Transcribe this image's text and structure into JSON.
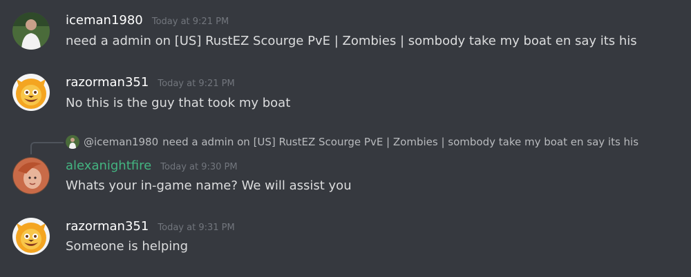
{
  "messages": [
    {
      "username": "iceman1980",
      "timestamp": "Today at 9:21 PM",
      "content": "need a admin on [US] RustEZ Scourge PvE | Zombies | sombody take my boat en say its  his",
      "username_color": "#ffffff",
      "avatar": "photo-avatar"
    },
    {
      "username": "razorman351",
      "timestamp": "Today at 9:21 PM",
      "content": "No this is the guy that took my boat",
      "username_color": "#ffffff",
      "avatar": "cartoon-lion-avatar"
    },
    {
      "reply": {
        "author": "@iceman1980",
        "content": "need a admin on [US] RustEZ Scourge PvE | Zombies | sombody take my boat en say its  his"
      },
      "username": "alexanightfire",
      "timestamp": "Today at 9:30 PM",
      "content": "Whats your in-game name? We will assist you",
      "username_color": "#43b581",
      "avatar": "photo-avatar"
    },
    {
      "username": "razorman351",
      "timestamp": "Today at 9:31 PM",
      "content": "Someone is helping",
      "username_color": "#ffffff",
      "avatar": "cartoon-lion-avatar"
    }
  ],
  "colors": {
    "background": "#36393f",
    "text": "#dcddde",
    "timestamp": "#72767d",
    "mod_name": "#43b581"
  }
}
